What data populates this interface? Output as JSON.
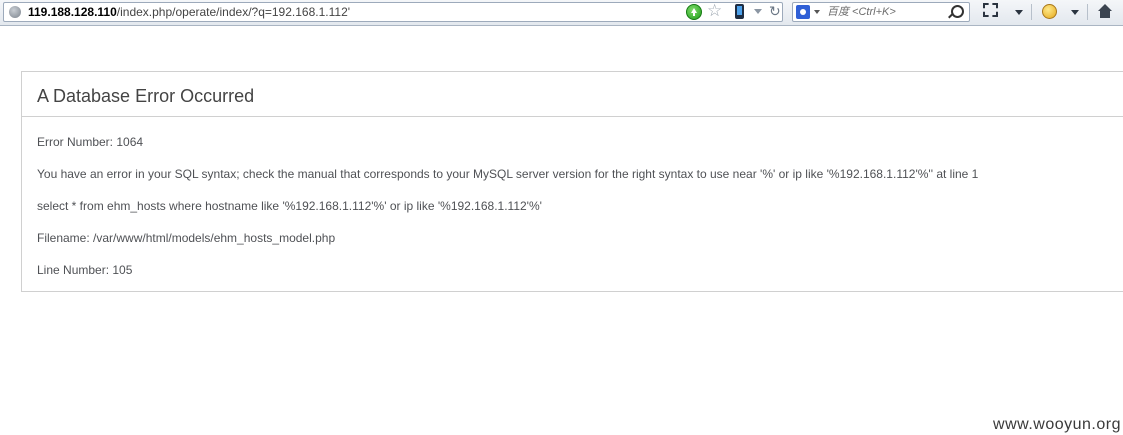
{
  "browser": {
    "url": {
      "host": "119.188.128.110",
      "path": "/index.php/operate/index/?q=192.168.1.112'"
    },
    "search": {
      "placeholder": "百度 <Ctrl+K>"
    },
    "icons": [
      "globe-icon",
      "go-icon",
      "star-icon",
      "phone-icon",
      "dropdown-icon",
      "reload-icon",
      "search-engine-icon",
      "search-icon",
      "snip-icon",
      "face-icon",
      "home-icon"
    ]
  },
  "error": {
    "heading": "A Database Error Occurred",
    "lines": [
      "Error Number: 1064",
      "You have an error in your SQL syntax; check the manual that corresponds to your MySQL server version for the right syntax to use near '%' or ip like '%192.168.1.112'%'' at line 1",
      "select * from ehm_hosts where hostname like '%192.168.1.112'%' or ip like '%192.168.1.112'%'",
      "Filename: /var/www/html/models/ehm_hosts_model.php",
      "Line Number: 105"
    ]
  },
  "watermark": "www.wooyun.org"
}
